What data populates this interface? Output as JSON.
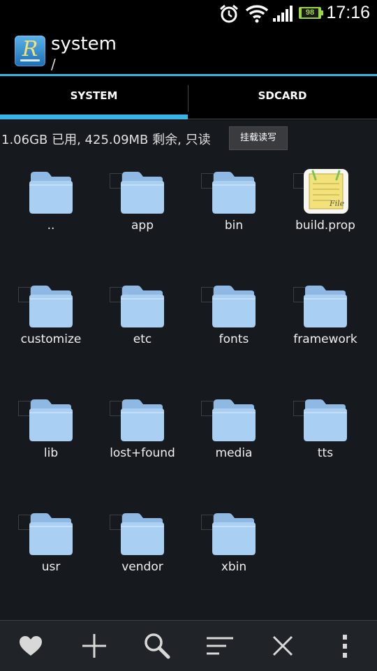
{
  "status_bar": {
    "time": "17:16",
    "battery_level": "98",
    "icons": [
      "alarm-icon",
      "wifi-icon",
      "signal-icon",
      "battery-icon"
    ]
  },
  "action_bar": {
    "title": "system",
    "subtitle": "/",
    "logo_letter": "R"
  },
  "tabs": [
    {
      "label": "SYSTEM",
      "selected": true
    },
    {
      "label": "SDCARD",
      "selected": false
    }
  ],
  "storage": {
    "info": "1.06GB 已用, 425.09MB 剩余, 只读",
    "mount_button": "挂载读写"
  },
  "files": [
    {
      "name": "..",
      "type": "folder"
    },
    {
      "name": "app",
      "type": "folder"
    },
    {
      "name": "bin",
      "type": "folder"
    },
    {
      "name": "build.prop",
      "type": "file"
    },
    {
      "name": "customize",
      "type": "folder"
    },
    {
      "name": "etc",
      "type": "folder"
    },
    {
      "name": "fonts",
      "type": "folder"
    },
    {
      "name": "framework",
      "type": "folder"
    },
    {
      "name": "lib",
      "type": "folder"
    },
    {
      "name": "lost+found",
      "type": "folder"
    },
    {
      "name": "media",
      "type": "folder"
    },
    {
      "name": "tts",
      "type": "folder"
    },
    {
      "name": "usr",
      "type": "folder"
    },
    {
      "name": "vendor",
      "type": "folder"
    },
    {
      "name": "xbin",
      "type": "folder"
    }
  ],
  "file_icon_text": "File",
  "bottom_bar": [
    "heart-icon",
    "add-icon",
    "search-icon",
    "sort-icon",
    "close-icon",
    "overflow-menu-icon"
  ],
  "colors": {
    "accent": "#33b5e5",
    "folder": "#a9cff3",
    "background": "#16191d"
  }
}
